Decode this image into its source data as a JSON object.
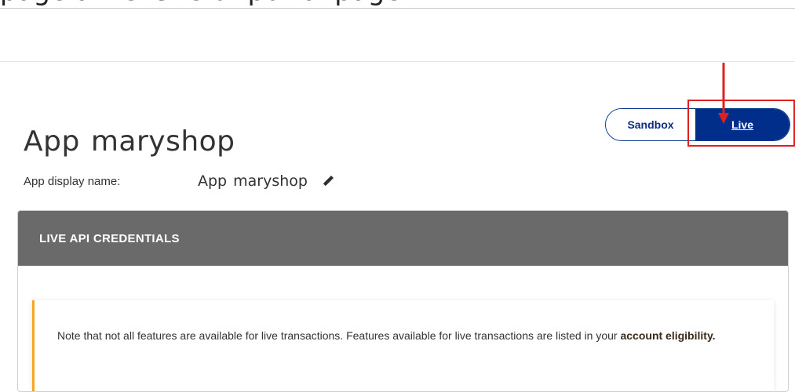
{
  "top_text": "page a website or portal page",
  "header": {
    "title_part1": "App",
    "title_part2": "maryshop"
  },
  "environment_toggle": {
    "sandbox_label": "Sandbox",
    "live_label": "Live",
    "selected": "Live"
  },
  "display_name": {
    "label": "App display name:",
    "value_part1": "App",
    "value_part2": "maryshop",
    "edit_icon": "pencil-icon"
  },
  "credentials": {
    "section_title": "LIVE API CREDENTIALS",
    "note_text": "Note that not all features are available for live transactions. Features available for live transactions are listed in your ",
    "note_link": "account eligibility."
  },
  "colors": {
    "primary": "#002e8a",
    "header_bg": "#6a6a6a",
    "note_accent": "#f5a623",
    "annotation": "#e02020"
  }
}
